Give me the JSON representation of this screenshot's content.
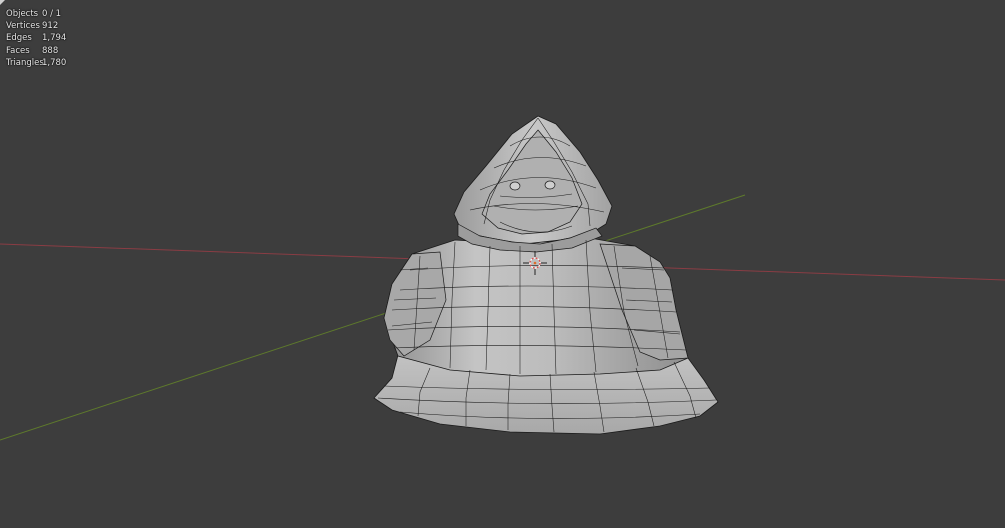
{
  "viewport": {
    "background": "#3d3d3d",
    "axis_x_color": "#8a3d44",
    "axis_y_color": "#5e7a2c",
    "mesh_color": "#b8b8b8",
    "wire_color": "#1a1a1a"
  },
  "stats": [
    {
      "label": "Objects",
      "value": "0 / 1"
    },
    {
      "label": "Vertices",
      "value": "912"
    },
    {
      "label": "Edges",
      "value": "1,794"
    },
    {
      "label": "Faces",
      "value": "888"
    },
    {
      "label": "Triangles",
      "value": "1,780"
    }
  ],
  "icons": {
    "origin": "3d-cursor-icon",
    "corner": "viewport-corner-icon"
  }
}
